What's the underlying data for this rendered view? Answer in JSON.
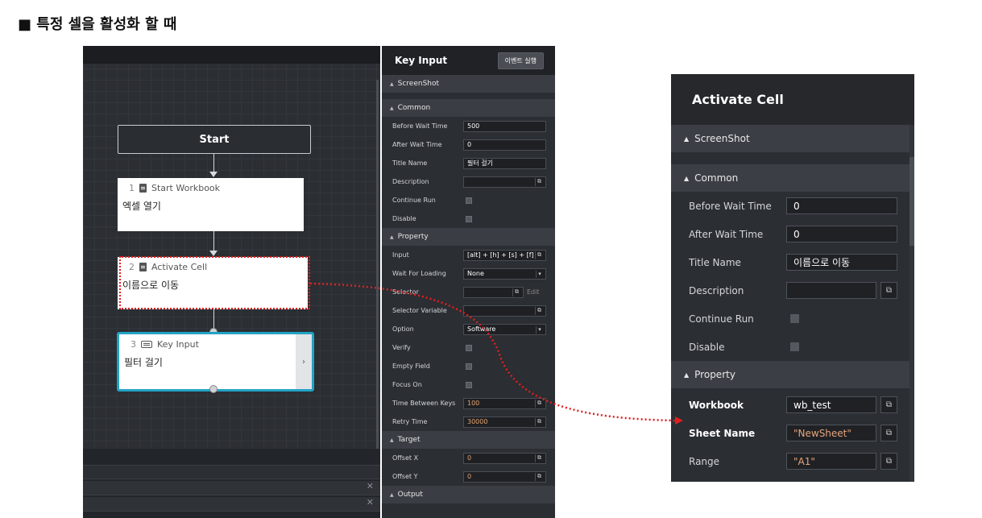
{
  "heading": "■ 특정 셀을 활성화 할 때",
  "canvas": {
    "start_label": "Start",
    "nodes": [
      {
        "num": "1",
        "title": "Start Workbook",
        "subtitle": "엑셀 열기"
      },
      {
        "num": "2",
        "title": "Activate Cell",
        "subtitle": "이름으로 이동"
      },
      {
        "num": "3",
        "title": "Key Input",
        "subtitle": "필터 걸기"
      }
    ],
    "close_glyph": "✕",
    "expand_glyph": "›"
  },
  "key_input_panel": {
    "title": "Key Input",
    "event_button": "이벤트 실행",
    "sections": {
      "screenshot": "ScreenShot",
      "common": "Common",
      "property": "Property",
      "target": "Target",
      "output": "Output"
    },
    "common": {
      "before_wait_time": {
        "label": "Before Wait Time",
        "value": "500"
      },
      "after_wait_time": {
        "label": "After Wait Time",
        "value": "0"
      },
      "title_name": {
        "label": "Title Name",
        "value": "필터 걸기"
      },
      "description": {
        "label": "Description",
        "value": ""
      },
      "continue_run": {
        "label": "Continue Run"
      },
      "disable": {
        "label": "Disable"
      }
    },
    "property": {
      "input": {
        "label": "Input",
        "value": "[alt] + [h] + [s] + [f]"
      },
      "wait_for_loading": {
        "label": "Wait For Loading",
        "value": "None"
      },
      "selector": {
        "label": "Selector",
        "value": "",
        "edit": "Edit"
      },
      "selector_variable": {
        "label": "Selector Variable",
        "value": ""
      },
      "option": {
        "label": "Option",
        "value": "Software"
      },
      "verify": {
        "label": "Verify"
      },
      "empty_field": {
        "label": "Empty Field"
      },
      "focus_on": {
        "label": "Focus On"
      },
      "time_between_keys": {
        "label": "Time Between Keys",
        "value": "100"
      },
      "retry_time": {
        "label": "Retry Time",
        "value": "30000"
      }
    },
    "target": {
      "offset_x": {
        "label": "Offset X",
        "value": "0"
      },
      "offset_y": {
        "label": "Offset Y",
        "value": "0"
      }
    }
  },
  "activate_cell_panel": {
    "title": "Activate Cell",
    "sections": {
      "screenshot": "ScreenShot",
      "common": "Common",
      "property": "Property"
    },
    "common": {
      "before_wait_time": {
        "label": "Before Wait Time",
        "value": "0"
      },
      "after_wait_time": {
        "label": "After Wait Time",
        "value": "0"
      },
      "title_name": {
        "label": "Title Name",
        "value": "이름으로 이동"
      },
      "description": {
        "label": "Description",
        "value": ""
      },
      "continue_run": {
        "label": "Continue Run"
      },
      "disable": {
        "label": "Disable"
      }
    },
    "property": {
      "workbook": {
        "label": "Workbook",
        "value": "wb_test"
      },
      "sheet_name": {
        "label": "Sheet Name",
        "value": "\"NewSheet\""
      },
      "range": {
        "label": "Range",
        "value": "\"A1\""
      }
    }
  },
  "icons": {
    "external_link": "⧉",
    "dropdown": "▾",
    "collapse": "▲"
  },
  "colors": {
    "selection_highlight": "#e02020",
    "active_node_border": "#22a3c4",
    "panel_bg": "#2b2e33",
    "string_value": "#e8a57a"
  }
}
